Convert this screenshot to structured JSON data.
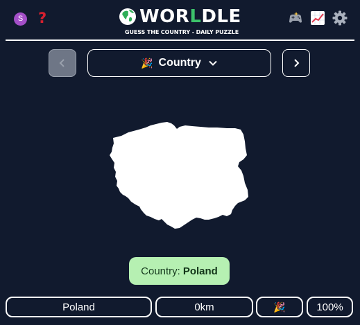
{
  "header": {
    "avatar_letter": "S",
    "help_symbol": "?",
    "logo_prefix": "WOR",
    "logo_highlight": "L",
    "logo_suffix": "DLE",
    "subtitle": "GUESS THE COUNTRY - DAILY PUZZLE",
    "icons": [
      "avatar-icon",
      "help-icon",
      "globe-icon",
      "games-icon",
      "stats-icon",
      "settings-icon"
    ]
  },
  "nav": {
    "prev_icon": "chevron-left-icon",
    "next_icon": "chevron-right-icon",
    "mode_emoji": "🎉",
    "mode_label": "Country",
    "mode_dropdown_icon": "chevron-down-icon"
  },
  "puzzle": {
    "shape_icon": "country-silhouette"
  },
  "answer": {
    "prefix": "Country:",
    "name": "Poland"
  },
  "guesses": [
    {
      "country": "Poland",
      "distance": "0km",
      "direction": "🎉",
      "proximity": "100%"
    }
  ],
  "colors": {
    "background": "#111a2e",
    "logo_highlight": "#3cc26a",
    "answer_bg": "#b6f0b2",
    "avatar": "#a44fc8",
    "help": "#d6202f"
  }
}
